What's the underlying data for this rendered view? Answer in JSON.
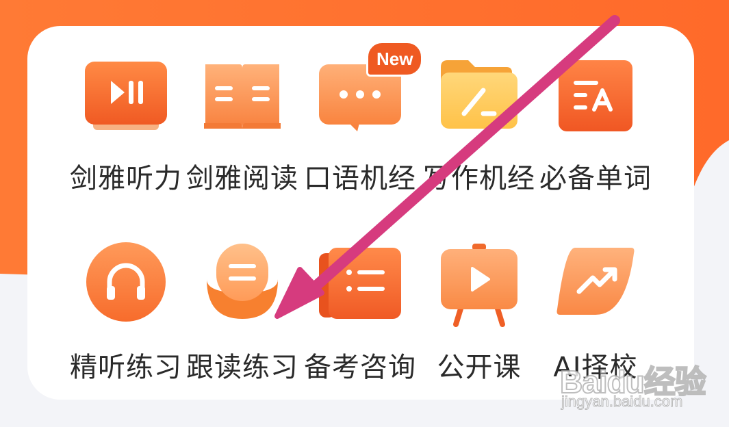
{
  "colors": {
    "accent": "#f26a2d",
    "accent_light": "#ffb37a",
    "arrow": "#d63b7e",
    "badge": "#ef5a22",
    "label": "#2a2a2a"
  },
  "menu": {
    "row1": [
      {
        "label": "剑雅听力",
        "icon": "play-pause-icon"
      },
      {
        "label": "剑雅阅读",
        "icon": "open-book-icon"
      },
      {
        "label": "口语机经",
        "icon": "chat-bubble-icon",
        "badge": "New"
      },
      {
        "label": "写作机经",
        "icon": "folder-pen-icon"
      },
      {
        "label": "必备单词",
        "icon": "vocabulary-icon"
      }
    ],
    "row2": [
      {
        "label": "精听练习",
        "icon": "headphones-icon"
      },
      {
        "label": "跟读练习",
        "icon": "microphone-icon"
      },
      {
        "label": "备考咨询",
        "icon": "list-icon"
      },
      {
        "label": "公开课",
        "icon": "video-easel-icon"
      },
      {
        "label": "AI择校",
        "icon": "trend-up-icon"
      }
    ]
  },
  "watermark": {
    "logo": "Baidu经验",
    "url": "jingyan.baidu.com"
  }
}
